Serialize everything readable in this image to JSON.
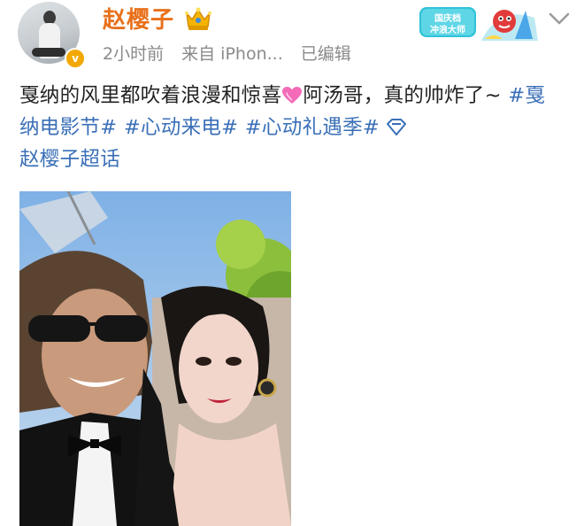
{
  "post": {
    "author": "赵樱子",
    "time": "2小时前",
    "source": "来自 iPhon...",
    "edited": "已编辑",
    "text_part1": "戛纳的风里都吹着浪漫和惊喜",
    "text_part2": "阿汤哥，真的帅炸了~",
    "tags": [
      "#戛纳电影节#",
      "#心动来电#",
      "#心动礼遇季#"
    ],
    "super_topic": "赵樱子超话"
  },
  "badges": {
    "verified": "v",
    "campaign_label": "国庆档 冲浪大师"
  },
  "icons": {
    "crown": "crown-badge-icon",
    "heart": "pink-heart-icon",
    "topic": "diamond-topic-icon",
    "menu": "chevron-down-icon"
  },
  "colors": {
    "author": "#e8701a",
    "tag": "#3a6fb7",
    "meta": "#8a8a8a"
  }
}
